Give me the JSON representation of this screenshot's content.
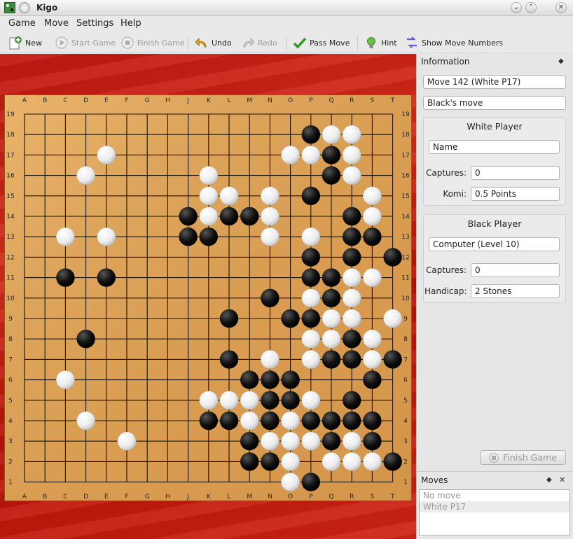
{
  "window": {
    "title": "Kigo"
  },
  "menu": [
    "Game",
    "Move",
    "Settings",
    "Help"
  ],
  "toolbar": {
    "new": "New",
    "start_game": "Start Game",
    "finish_game": "Finish Game",
    "undo": "Undo",
    "redo": "Redo",
    "pass_move": "Pass Move",
    "hint": "Hint",
    "show_move_numbers": "Show Move Numbers"
  },
  "board": {
    "columns": [
      "A",
      "B",
      "C",
      "D",
      "E",
      "F",
      "G",
      "H",
      "J",
      "K",
      "L",
      "M",
      "N",
      "O",
      "P",
      "Q",
      "R",
      "S",
      "T"
    ],
    "size": 19,
    "black": [
      "P18",
      "Q17",
      "Q16",
      "P15",
      "J14",
      "L14",
      "M14",
      "R14",
      "J13",
      "K13",
      "R13",
      "S13",
      "P12",
      "R12",
      "T12",
      "C11",
      "E11",
      "P11",
      "Q11",
      "N10",
      "Q10",
      "L9",
      "O9",
      "P9",
      "D8",
      "R8",
      "L7",
      "Q7",
      "R7",
      "T7",
      "M6",
      "N6",
      "O6",
      "S6",
      "N5",
      "O5",
      "R5",
      "K4",
      "L4",
      "N4",
      "P4",
      "Q4",
      "R4",
      "S4",
      "M3",
      "Q3",
      "S3",
      "M2",
      "N2",
      "T2",
      "P1"
    ],
    "white": [
      "Q18",
      "R18",
      "E17",
      "O17",
      "P17",
      "R17",
      "D16",
      "K16",
      "R16",
      "K15",
      "L15",
      "N15",
      "S15",
      "K14",
      "N14",
      "S14",
      "C13",
      "E13",
      "N13",
      "P13",
      "R11",
      "S11",
      "P10",
      "R10",
      "Q9",
      "R9",
      "T9",
      "P8",
      "Q8",
      "S8",
      "N7",
      "P7",
      "S7",
      "C6",
      "K5",
      "L5",
      "M5",
      "P5",
      "D4",
      "M4",
      "O4",
      "F3",
      "N3",
      "O3",
      "P3",
      "R3",
      "O2",
      "Q2",
      "R2",
      "S2",
      "O1"
    ]
  },
  "info": {
    "title": "Information",
    "move": "Move 142 (White P17)",
    "status": "Black's move",
    "white": {
      "title": "White Player",
      "name": "Name",
      "captures_label": "Captures:",
      "captures": "0",
      "komi_label": "Komi:",
      "komi": "0.5 Points"
    },
    "black": {
      "title": "Black Player",
      "name": "Computer (Level 10)",
      "captures_label": "Captures:",
      "captures": "0",
      "handicap_label": "Handicap:",
      "handicap": "2 Stones"
    },
    "finish_button": "Finish Game"
  },
  "moves": {
    "title": "Moves",
    "items": [
      "No move",
      "White P17"
    ]
  },
  "colors": {
    "board_bg": "#c01810",
    "goban": "#dca45a",
    "black_stone": "#111111",
    "white_stone": "#f4f4f4"
  }
}
